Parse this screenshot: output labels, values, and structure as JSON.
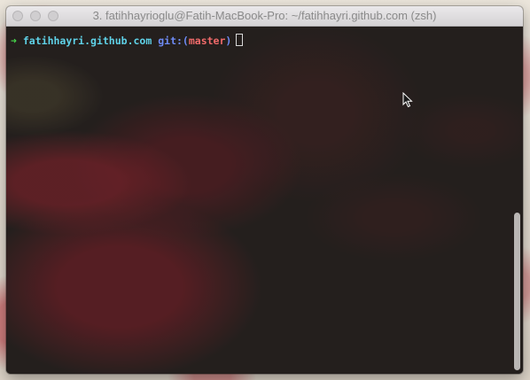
{
  "window": {
    "title": "3. fatihhayrioglu@Fatih-MacBook-Pro: ~/fatihhayri.github.com (zsh)"
  },
  "terminal": {
    "prompt_arrow": "➜",
    "directory": "fatihhayri.github.com",
    "git_prefix": "git:(",
    "branch": "master",
    "git_suffix": ")"
  },
  "colors": {
    "arrow": "#46d84b",
    "directory": "#5fd2e8",
    "git": "#6e8bf5",
    "branch": "#f06a6a",
    "background": "#2b2624"
  },
  "icons": {
    "close": "close-button",
    "minimize": "minimize-button",
    "zoom": "zoom-button",
    "pointer": "mouse-pointer-icon"
  }
}
